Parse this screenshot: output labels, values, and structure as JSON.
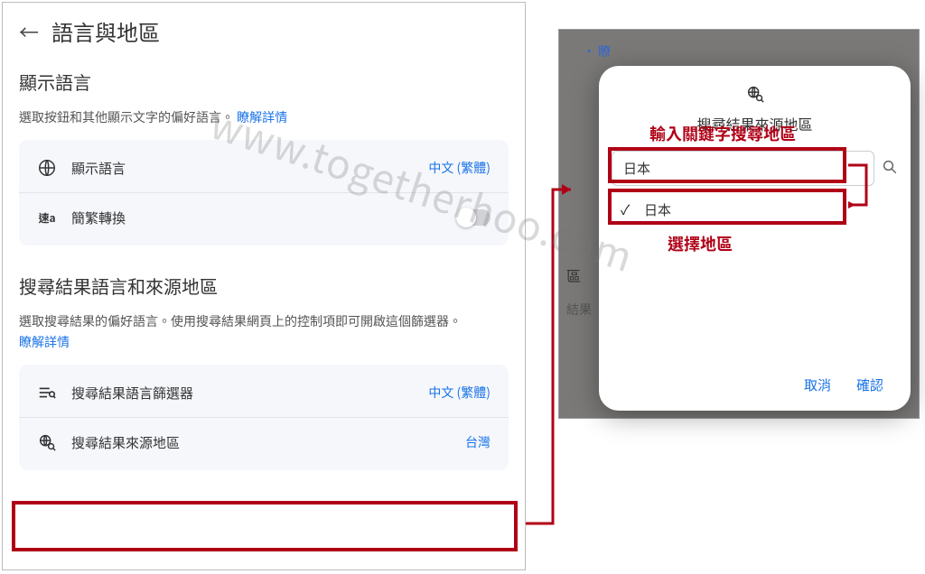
{
  "header": {
    "title": "語言與地區"
  },
  "section1": {
    "title": "顯示語言",
    "desc": "選取按鈕和其他顯示文字的偏好語言。",
    "learn_more": "瞭解詳情",
    "row1_label": "顯示語言",
    "row1_value": "中文 (繁體)",
    "row2_label": "簡繁轉換",
    "row2_icon_text": "速a"
  },
  "section2": {
    "title": "搜尋結果語言和來源地區",
    "desc": "選取搜尋結果的偏好語言。使用搜尋結果網頁上的控制項即可開啟這個篩選器。",
    "learn_more": "瞭解詳情",
    "row1_label": "搜尋結果語言篩選器",
    "row1_value": "中文 (繁體)",
    "row2_label": "搜尋結果來源地區",
    "row2_value": "台灣"
  },
  "dialog": {
    "title": "搜尋結果來源地區",
    "search_value": "日本",
    "result1": "日本",
    "cancel": "取消",
    "confirm": "確認"
  },
  "bg": {
    "link_fragment": "• 瞭",
    "heading_fragment": "區",
    "desc_fragment": "結果"
  },
  "annotations": {
    "input_hint": "輸入關鍵字搜尋地區",
    "select_hint": "選擇地區"
  },
  "watermark": "www.togetherhoo.com"
}
